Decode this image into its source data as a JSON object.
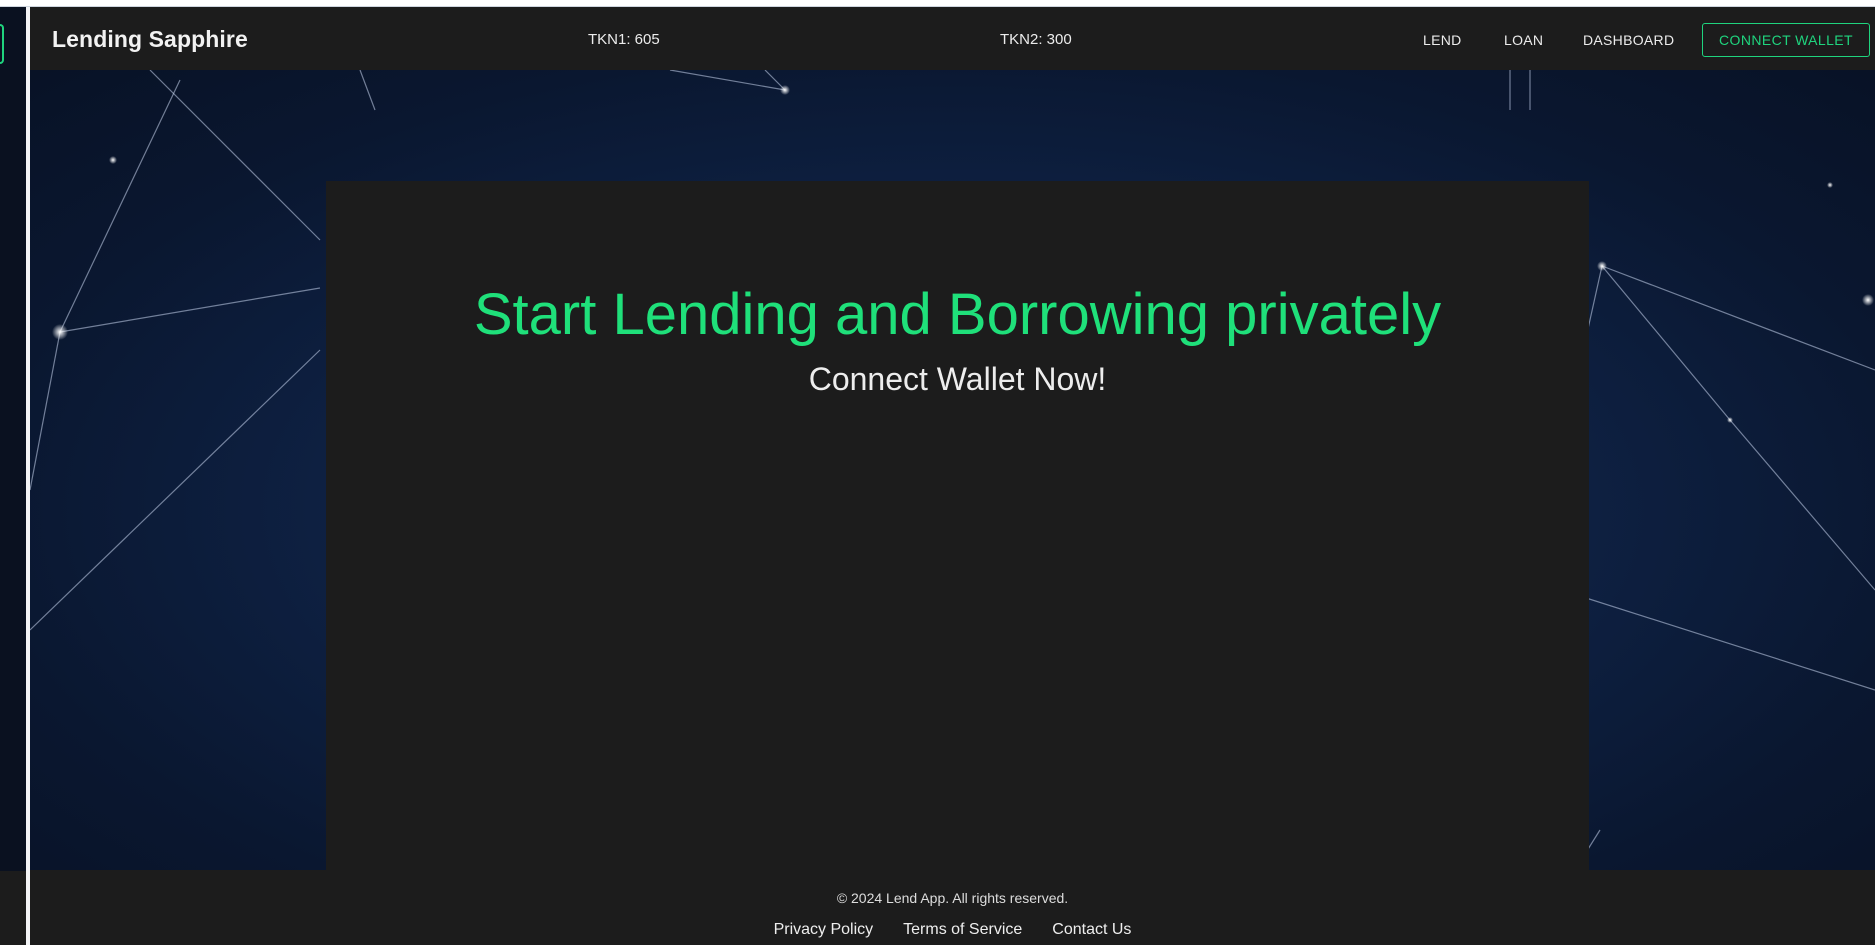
{
  "navbar": {
    "brand": "Lending Sapphire",
    "tokens": [
      {
        "label": "TKN1: 605"
      },
      {
        "label": "TKN2: 300"
      }
    ],
    "links": [
      {
        "label": "LEND"
      },
      {
        "label": "LOAN"
      },
      {
        "label": "DASHBOARD"
      }
    ],
    "connect_label": "CONNECT WALLET"
  },
  "hero": {
    "headline": "Start Lending and Borrowing privately",
    "subhead": "Connect Wallet Now!"
  },
  "footer": {
    "copyright": "© 2024 Lend App. All rights reserved.",
    "links": [
      {
        "label": "Privacy Policy"
      },
      {
        "label": "Terms of Service"
      },
      {
        "label": "Contact Us"
      }
    ]
  },
  "colors": {
    "accent": "#1fe07a",
    "panel": "#1c1c1c",
    "background": "#0c1a35"
  }
}
